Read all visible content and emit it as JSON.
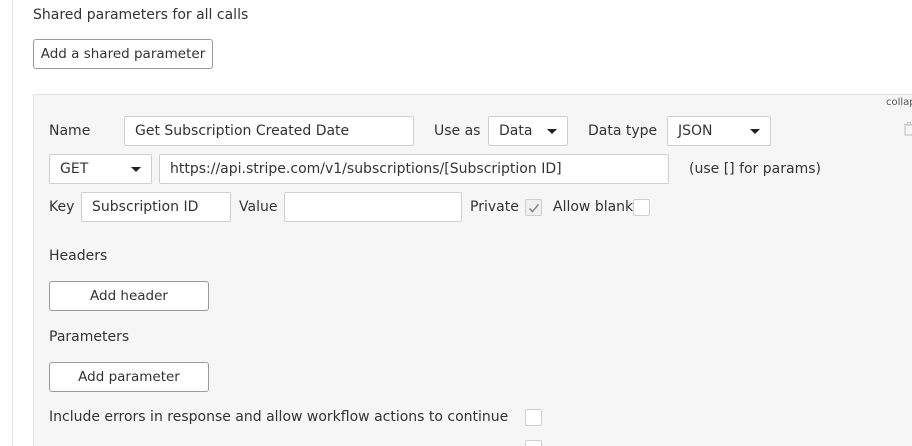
{
  "shared": {
    "label": "Shared parameters for all calls",
    "add_button": "Add a shared parameter"
  },
  "call": {
    "collapse_link": "collapse",
    "name_label": "Name",
    "name_value": "Get Subscription Created Date",
    "use_as_label": "Use as",
    "use_as_value": "Data",
    "data_type_label": "Data type",
    "data_type_value": "JSON",
    "method_value": "GET",
    "url_value": "https://api.stripe.com/v1/subscriptions/[Subscription ID]",
    "url_hint": "(use [] for params)",
    "key_label": "Key",
    "key_value": "Subscription ID",
    "value_label": "Value",
    "value_value": "",
    "private_label": "Private",
    "private_checked": true,
    "allow_blank_label": "Allow blank",
    "allow_blank_checked": false,
    "headers_label": "Headers",
    "add_header_button": "Add header",
    "parameters_label": "Parameters",
    "add_parameter_button": "Add parameter",
    "include_errors_label": "Include errors in response and allow workflow actions to continue",
    "include_errors_checked": false
  },
  "icons": {
    "trash": "trash-icon",
    "check": "check-icon",
    "dropdown": "chevron-down-icon"
  },
  "colors": {
    "panel_bg": "#f6f6f6",
    "border": "#cfcfcf",
    "text": "#333333"
  }
}
